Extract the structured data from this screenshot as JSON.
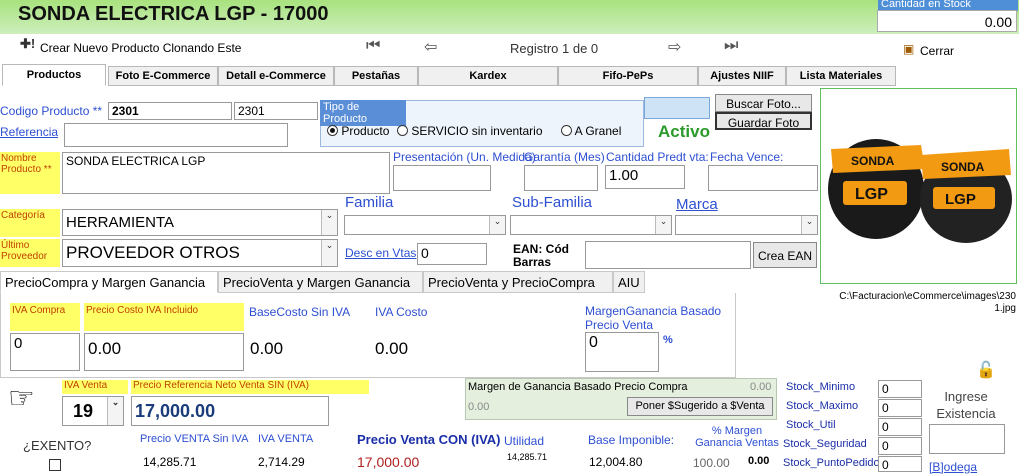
{
  "header": {
    "title": "SONDA ELECTRICA LGP - 17000",
    "stock_label": "Cantidad en Stock",
    "stock_value": "0.00"
  },
  "toolbar": {
    "clone_label": "Crear Nuevo Producto Clonando Este",
    "record_label": "Registro 1 de 0",
    "close_label": "Cerrar"
  },
  "tabs": [
    "Productos",
    "Foto E-Commerce",
    "Detall e-Commerce",
    "Pestañas",
    "Kardex",
    "Fifo-PePs",
    "Ajustes NIIF",
    "Lista Materiales"
  ],
  "product": {
    "codigo_label": "Codigo Producto **",
    "codigo_value": "2301",
    "codigo_value2": "2301",
    "referencia_label": "Referencia",
    "referencia_value": "",
    "nombre_label": "Nombre Producto **",
    "nombre_value": "SONDA ELECTRICA LGP",
    "categoria_label": "Categoría",
    "categoria_value": "HERRAMIENTA",
    "proveedor_label": "Último Proveedor",
    "proveedor_value": "PROVEEDOR OTROS",
    "presentacion_label": "Presentación (Un. Medida)",
    "garantia_label": "Garantía (Mes)",
    "cantidad_label": "Cantidad Predt vta:",
    "cantidad_value": "1.00",
    "fecha_label": "Fecha Vence:",
    "familia_label": "Familia",
    "subfamilia_label": "Sub-Familia",
    "marca_label": "Marca",
    "desc_label": "Desc en Vtas",
    "desc_value": "0",
    "ean_label": "EAN: Cód Barras",
    "crea_ean_label": "Crea EAN"
  },
  "tipo_producto": {
    "title": "Tipo de Producto",
    "options": [
      "Producto",
      "SERVICIO sin inventario",
      "A Granel"
    ],
    "selected": "Producto"
  },
  "status": "Activo",
  "foto": {
    "buscar_label": "Buscar Foto...",
    "guardar_label": "Guardar Foto",
    "path": "C:\\Facturacion\\eCommerce\\images\\2301.jpg",
    "brand_text": "SONDA",
    "logo_text": "LGP"
  },
  "price_tabs": [
    "PrecioCompra y Margen Ganancia",
    "PrecioVenta y Margen Ganancia",
    "PrecioVenta y PrecioCompra",
    "AIU"
  ],
  "compra": {
    "iva_label": "IVA Compra",
    "iva_value": "0",
    "costo_iva_label": "Precio Costo IVA Incluido",
    "costo_iva_value": "0.00",
    "base_label": "BaseCosto Sin IVA",
    "base_value": "0.00",
    "iva_costo_label": "IVA Costo",
    "iva_costo_value": "0.00",
    "margen_label": "MargenGanancia Basado Precio Venta",
    "margen_value": "0",
    "pct": "%"
  },
  "venta": {
    "iva_label": "IVA Venta",
    "iva_value": "19",
    "ref_label": "Precio Referencia Neto Venta SIN (IVA)",
    "ref_value": "17,000.00",
    "margen_compra_label": "Margen de Ganancia Basado Precio Compra",
    "margen_compra_value1": "0.00",
    "margen_compra_value2": "0.00",
    "sugerido_label": "Poner $Sugerido a $Venta",
    "exento_label": "¿EXENTO?",
    "pv_sin_iva_label": "Precio VENTA Sin IVA",
    "pv_sin_iva_value": "14,285.71",
    "iva_venta_label": "IVA VENTA",
    "iva_venta_value": "2,714.29",
    "pv_con_iva_label": "Precio Venta CON (IVA)",
    "pv_con_iva_value": "17,000.00",
    "utilidad_label": "Utilidad",
    "utilidad_value": "14,285.71",
    "base_label": "Base Imponible:",
    "base_value": "12,004.80",
    "margen_ventas_label": "% Margen Ganancia Ventas",
    "margen_ventas_value1": "100.00",
    "margen_ventas_value2": "0.00"
  },
  "stock_fields": [
    {
      "label": "Stock_Minimo",
      "value": "0"
    },
    {
      "label": "Stock_Maximo",
      "value": "0"
    },
    {
      "label": "Stock_Util",
      "value": "0"
    },
    {
      "label": "Stock_Seguridad",
      "value": "0"
    },
    {
      "label": "Stock_PuntoPedido",
      "value": "0"
    }
  ],
  "existencia": {
    "label": "Ingrese Existencia",
    "bodega_label": "[B]odega"
  }
}
